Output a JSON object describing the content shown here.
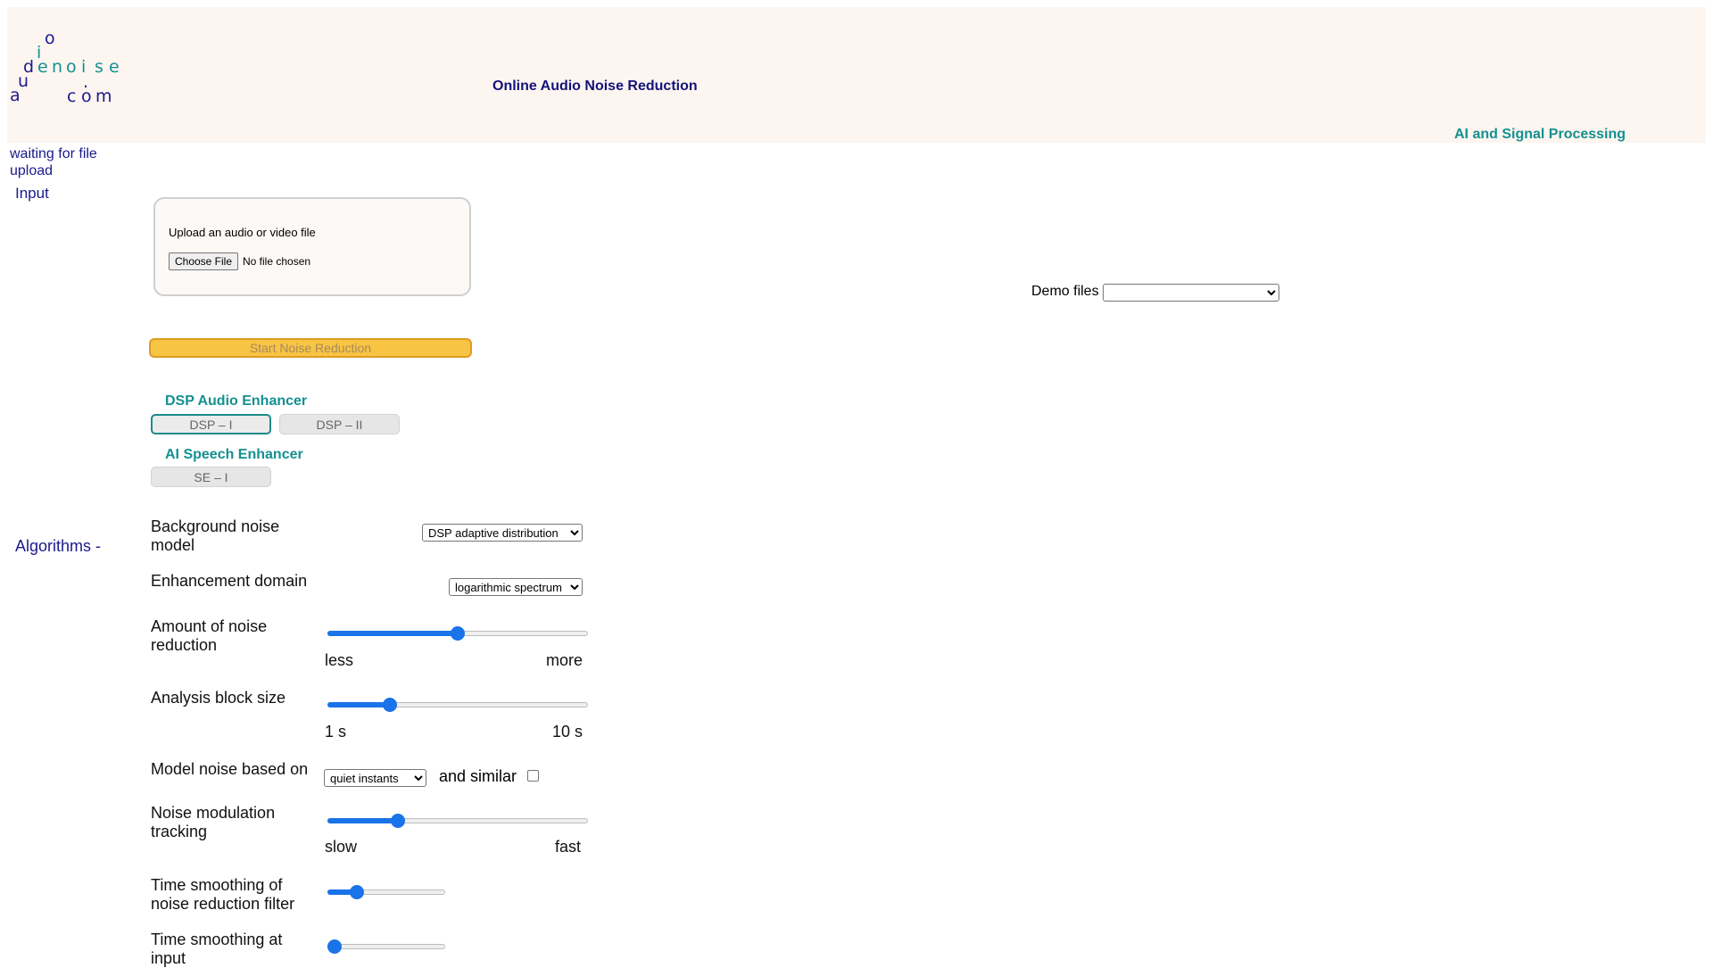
{
  "header": {
    "logo": [
      "a",
      "u",
      "d",
      "i",
      "o",
      "d",
      "e",
      "n",
      "o",
      "i",
      "s",
      "e",
      ".",
      "c",
      "o",
      "m"
    ],
    "site_title": "Online Audio Noise Reduction",
    "tagline": "AI and Signal Processing"
  },
  "sidebar": {
    "status": "waiting for file upload",
    "input_label": "Input",
    "algorithms_label": "Algorithms -"
  },
  "upload": {
    "label": "Upload an audio or video file",
    "choose_button": "Choose File",
    "no_file": "No file chosen"
  },
  "demo": {
    "label": "Demo files",
    "selected": ""
  },
  "start_button": "Start Noise Reduction",
  "sections": {
    "dsp_title": "DSP Audio Enhancer",
    "dsp_buttons": [
      "DSP – I",
      "DSP – II"
    ],
    "ai_title": "AI Speech Enhancer",
    "ai_buttons": [
      "SE – I"
    ]
  },
  "params": {
    "noise_model": {
      "label": "Background noise model",
      "selected": "DSP adaptive distribution"
    },
    "domain": {
      "label": "Enhancement domain",
      "selected": "logarithmic spectrum"
    },
    "amount": {
      "label": "Amount of noise reduction",
      "value": 0.5,
      "min_label": "less",
      "max_label": "more"
    },
    "block_size": {
      "label": "Analysis block size",
      "value": 0.24,
      "min_label": "1 s",
      "max_label": "10 s"
    },
    "model_based": {
      "label": "Model noise based on",
      "selected": "quiet instants",
      "and_similar": "and similar",
      "and_similar_checked": false
    },
    "modulation": {
      "label": "Noise modulation tracking",
      "value": 0.27,
      "min_label": "slow",
      "max_label": "fast"
    },
    "filter_smoothing": {
      "label": "Time smoothing of noise reduction filter",
      "value": 0.25
    },
    "input_smoothing": {
      "label": "Time smoothing at input",
      "value": 0.06
    }
  },
  "colors": {
    "navy": "#1a1a8c",
    "teal": "#159090",
    "accent": "#1a73e8",
    "start_button": "#f7c444",
    "header_bg": "#fdf5f0"
  }
}
